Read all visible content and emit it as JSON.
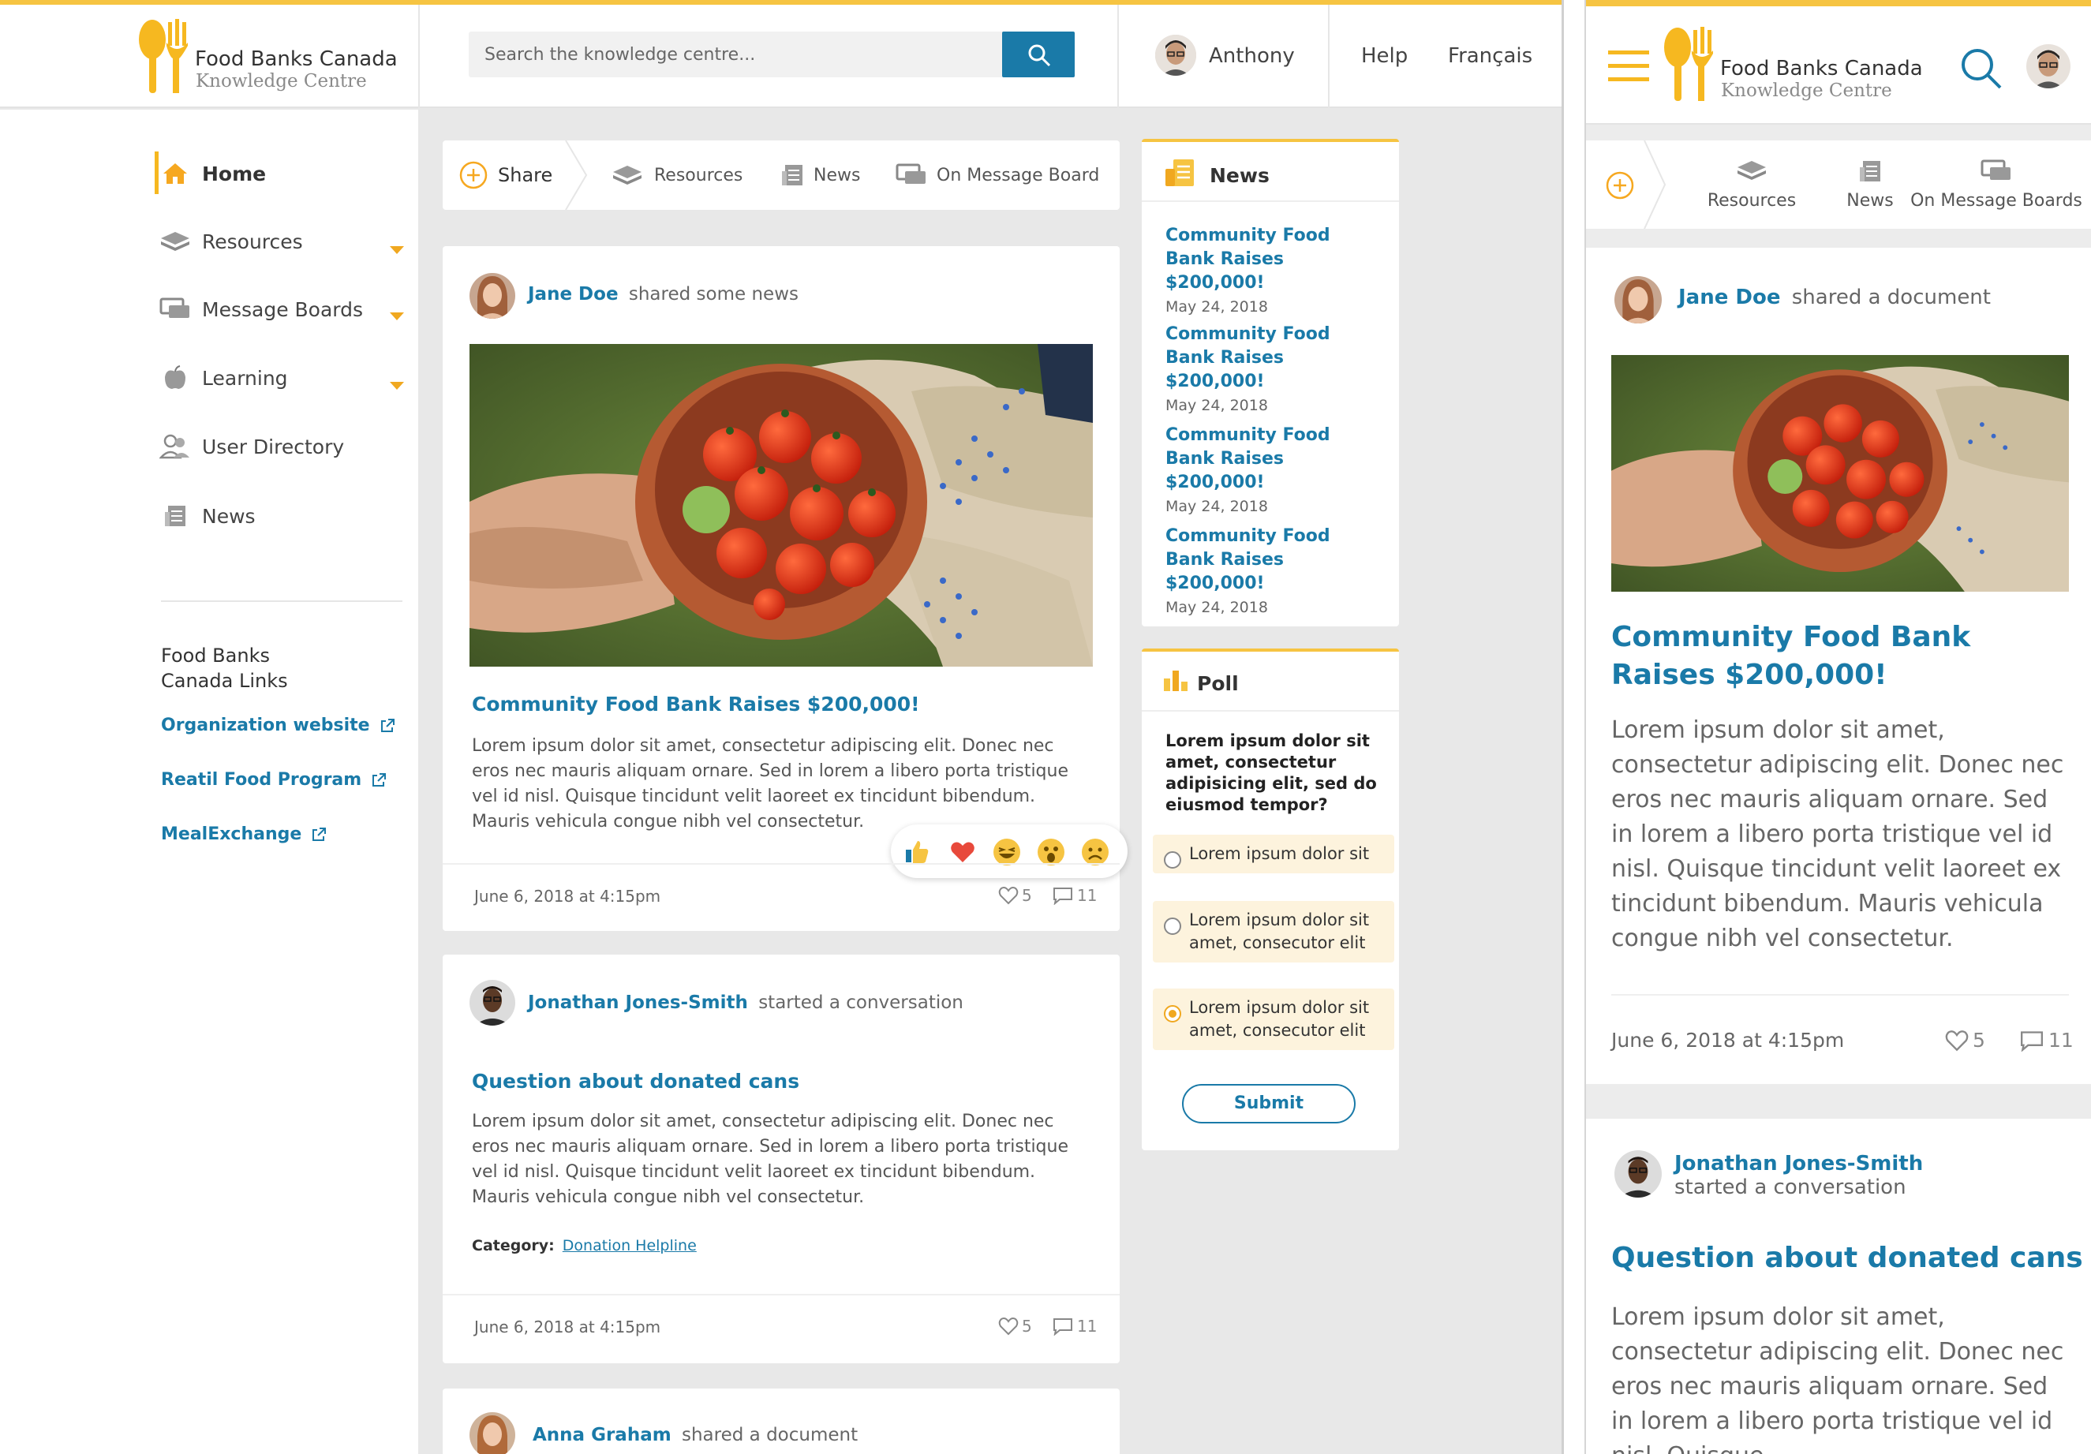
{
  "brand": {
    "name": "Food Banks Canada",
    "subtitle": "Knowledge Centre",
    "accent": "#f6c442",
    "link_color": "#1a7aa8"
  },
  "header": {
    "search_placeholder": "Search the knowledge centre...",
    "user_name": "Anthony",
    "help": "Help",
    "language": "Français"
  },
  "sidebar": {
    "items": [
      {
        "label": "Home",
        "icon": "home-icon",
        "active": true
      },
      {
        "label": "Resources",
        "icon": "stack-icon",
        "has_submenu": true
      },
      {
        "label": "Message Boards",
        "icon": "chat-bubbles-icon",
        "has_submenu": true
      },
      {
        "label": "Learning",
        "icon": "apple-icon",
        "has_submenu": true
      },
      {
        "label": "User Directory",
        "icon": "users-icon"
      },
      {
        "label": "News",
        "icon": "newspaper-icon"
      }
    ],
    "links_heading_1": "Food Banks",
    "links_heading_2": "Canada Links",
    "links": [
      "Organization website",
      "Reatil Food Program",
      "MealExchange"
    ]
  },
  "share_bar": {
    "share": "Share",
    "resources": "Resources",
    "news": "News",
    "message_board": "On Message Board"
  },
  "feed": [
    {
      "author": "Jane Doe",
      "action": "shared some news",
      "title": "Community Food Bank Raises $200,000!",
      "body": "Lorem ipsum dolor sit amet, consectetur adipiscing elit. Donec nec eros nec mauris aliquam ornare. Sed in lorem a libero porta tristique vel id nisl. Quisque tincidunt velit laoreet ex tincidunt bibendum. Mauris vehicula congue nibh vel consectetur.",
      "date": "June 6, 2018 at 4:15pm",
      "likes": "5",
      "comments": "11"
    },
    {
      "author": "Jonathan Jones-Smith",
      "action": "started a conversation",
      "title": "Question about donated cans",
      "body": "Lorem ipsum dolor sit amet, consectetur adipiscing elit. Donec nec eros nec mauris aliquam ornare. Sed in lorem a libero porta tristique vel id nisl. Quisque tincidunt velit laoreet ex tincidunt bibendum. Mauris vehicula congue nibh vel consectetur.",
      "category_label": "Category:",
      "category": "Donation Helpline",
      "date": "June 6, 2018 at 4:15pm",
      "likes": "5",
      "comments": "11"
    },
    {
      "author": "Anna Graham",
      "action": "shared a document"
    }
  ],
  "news_panel": {
    "heading": "News",
    "items": [
      {
        "title": "Community Food Bank Raises $200,000!",
        "date": "May 24, 2018"
      },
      {
        "title": "Community Food Bank Raises $200,000!",
        "date": "May 24, 2018"
      },
      {
        "title": "Community Food Bank Raises $200,000!",
        "date": "May 24, 2018"
      },
      {
        "title": "Community Food Bank Raises $200,000!",
        "date": "May 24, 2018"
      }
    ]
  },
  "poll": {
    "heading": "Poll",
    "question": "Lorem ipsum dolor sit amet, consectetur adipisicing elit, sed do eiusmod tempor?",
    "options": [
      "Lorem ipsum dolor sit",
      "Lorem ipsum dolor sit amet, consecutor elit",
      "Lorem ipsum dolor sit amet, consecutor elit"
    ],
    "selected_index": 2,
    "submit": "Submit"
  },
  "mobile": {
    "tabs": {
      "resources": "Resources",
      "news": "News",
      "message_boards": "On Message Boards"
    },
    "post1": {
      "author": "Jane Doe",
      "action": "shared a document",
      "title": "Community Food Bank Raises $200,000!",
      "body": "Lorem ipsum dolor sit amet, consectetur adipiscing elit. Donec nec eros nec mauris aliquam ornare. Sed in lorem a libero porta tristique vel id nisl. Quisque tincidunt velit laoreet ex tincidunt bibendum. Mauris vehicula congue nibh vel consectetur.",
      "date": "June 6, 2018 at 4:15pm",
      "likes": "5",
      "comments": "11"
    },
    "post2": {
      "author": "Jonathan Jones-Smith",
      "action": "started a conversation",
      "title": "Question about donated cans",
      "body": "Lorem ipsum dolor sit amet, consectetur adipiscing elit. Donec nec eros nec mauris aliquam ornare. Sed in lorem a libero porta tristique vel id nisl. Quisque"
    }
  }
}
